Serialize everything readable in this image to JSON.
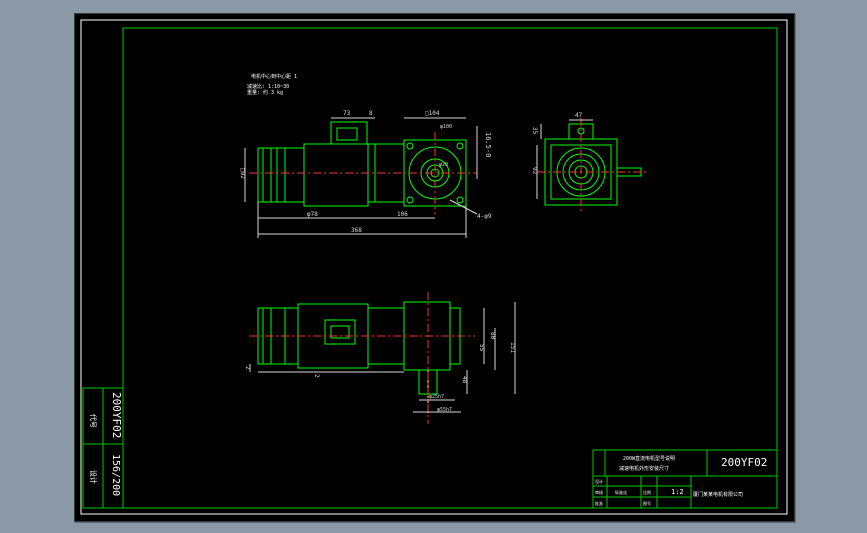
{
  "colors": {
    "background": "#000000",
    "window_frame": "#8a98a8",
    "frame_line": "#00c800",
    "outline": "#ffffff",
    "part_line": "#00ff00",
    "center_line": "#ff3030",
    "dimension": "#d8d8d8",
    "hidden_line": "#ffff00"
  },
  "notes": {
    "title": "电机中心到中心距 1",
    "line1": "减速比: 1:10~30",
    "line2": "重量: 约 3 kg"
  },
  "dimensions": {
    "d73": "73",
    "d8": "8",
    "sq104": "□104",
    "phi100": "φ100",
    "d165": "16.5-0",
    "phi20": "φ20",
    "sq92": "□92",
    "d278": "φ78",
    "d106": "106",
    "total": "368",
    "holes": "4-φ9",
    "d47": "47",
    "d35": "35",
    "d92v": "92",
    "d2": "2",
    "d2b": "2",
    "d55": "55",
    "d80": "80",
    "d151": "151",
    "d48": "48",
    "phi25": "φ25h7",
    "phi55": "φ55h7"
  },
  "side_vertical": {
    "model": "200YF02",
    "page": "156/200",
    "label_a": "代号",
    "label_b": "设计"
  },
  "title_block": {
    "model": "200YF02",
    "description_line1": "200W直流电机型号说明",
    "description_line2": "减速电机外形安装尺寸",
    "row_left": [
      "设计",
      "审核"
    ],
    "row_mid": [
      "标准化",
      "批准"
    ],
    "scale": "1:2",
    "company": "厦门某某电机有限公司",
    "cell_a": "比例",
    "cell_b": "图号"
  }
}
